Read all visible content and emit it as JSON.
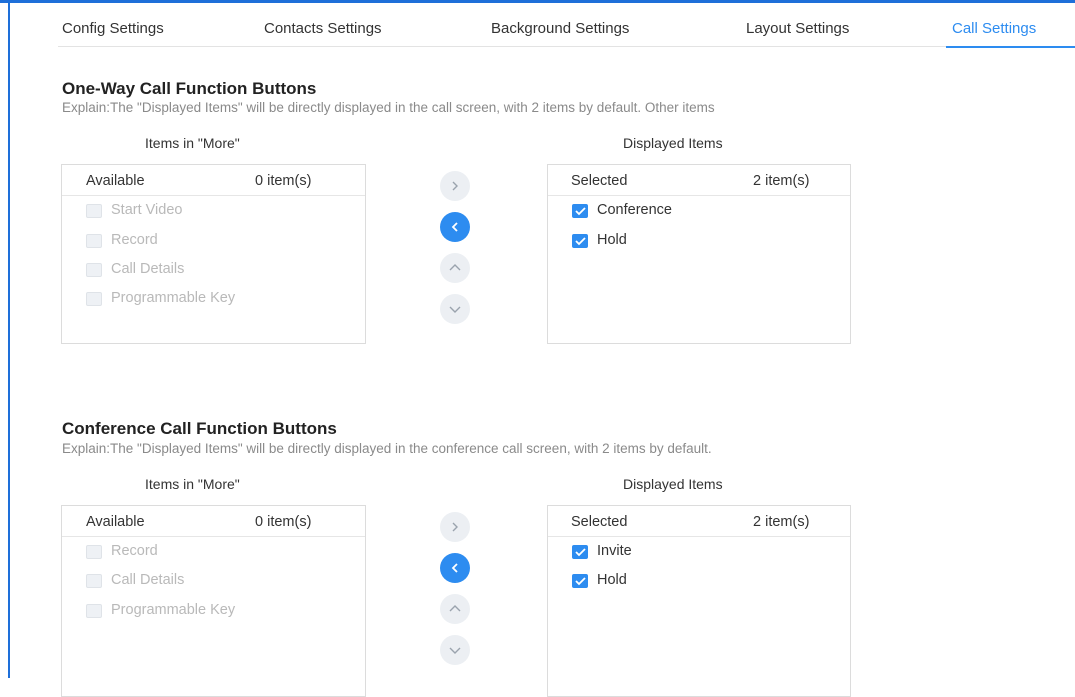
{
  "tabs": [
    {
      "label": "Config Settings",
      "active": false
    },
    {
      "label": "Contacts Settings",
      "active": false
    },
    {
      "label": "Background Settings",
      "active": false
    },
    {
      "label": "Layout Settings",
      "active": false
    },
    {
      "label": "Call Settings",
      "active": true
    }
  ],
  "colors": {
    "accent": "#2d8cf0",
    "disabled_text": "#b9b9b9",
    "frame": "#1e6fd9"
  },
  "sections": [
    {
      "title": "One-Way Call Function Buttons",
      "explain": "Explain:The \"Displayed Items\" will be directly displayed in the call screen, with 2 items by default. Other items",
      "more_caption": "Items in \"More\"",
      "displayed_caption": "Displayed Items",
      "available": {
        "header": "Available",
        "count": "0 item(s)",
        "items": [
          "Start Video",
          "Record",
          "Call Details",
          "Programmable Key"
        ]
      },
      "selected": {
        "header": "Selected",
        "count": "2 item(s)",
        "items": [
          "Conference",
          "Hold"
        ]
      },
      "transfer_buttons": [
        "chevron-right-icon",
        "chevron-left-icon",
        "chevron-up-icon",
        "chevron-down-icon"
      ]
    },
    {
      "title": "Conference Call Function Buttons",
      "explain": "Explain:The \"Displayed Items\" will be directly displayed in the conference call screen, with 2 items by default.",
      "more_caption": "Items in \"More\"",
      "displayed_caption": "Displayed Items",
      "available": {
        "header": "Available",
        "count": "0 item(s)",
        "items": [
          "Record",
          "Call Details",
          "Programmable Key"
        ]
      },
      "selected": {
        "header": "Selected",
        "count": "2 item(s)",
        "items": [
          "Invite",
          "Hold"
        ]
      },
      "transfer_buttons": [
        "chevron-right-icon",
        "chevron-left-icon",
        "chevron-up-icon",
        "chevron-down-icon"
      ]
    }
  ]
}
